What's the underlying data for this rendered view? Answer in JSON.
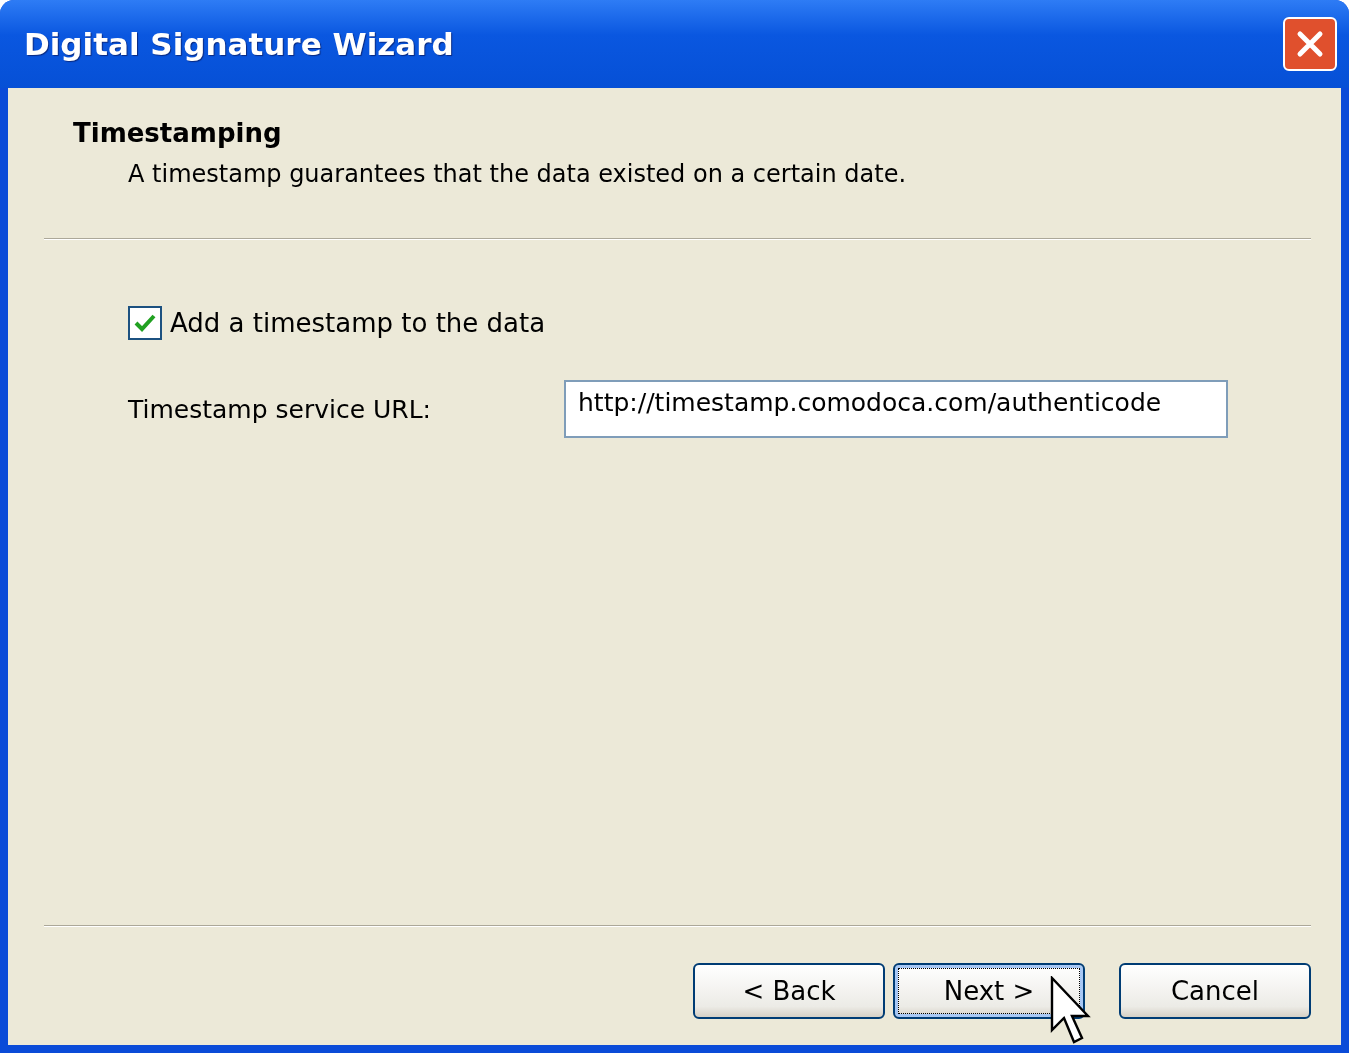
{
  "window": {
    "title": "Digital Signature Wizard"
  },
  "header": {
    "title": "Timestamping",
    "subtitle": "A timestamp guarantees that the data existed on a certain date."
  },
  "timestamp_checkbox": {
    "label": "Add a timestamp to the data",
    "checked": true
  },
  "url_field": {
    "label": "Timestamp service URL:",
    "value": "http://timestamp.comodoca.com/authenticode"
  },
  "buttons": [
    {
      "label": "< Back",
      "focused": false
    },
    {
      "label": "Next >",
      "focused": true
    },
    {
      "label": "Cancel",
      "focused": false
    }
  ]
}
